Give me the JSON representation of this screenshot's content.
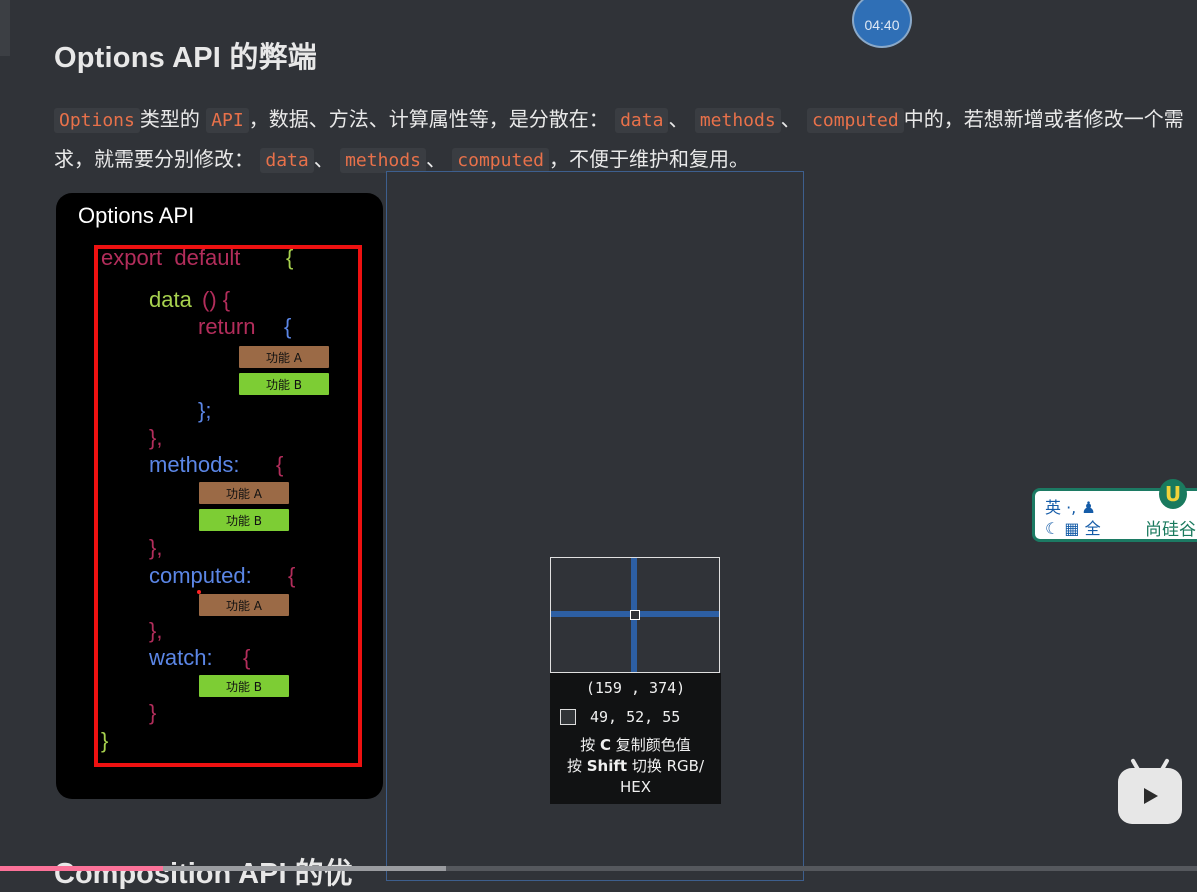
{
  "timer": "04:40",
  "heading": "Options API 的弊端",
  "paragraph": {
    "t1": "Options",
    "t2": "类型的",
    "t3": "API",
    "t4": "，数据、方法、计算属性等，是分散在：",
    "t5": "data",
    "t6": "、",
    "t7": "methods",
    "t8": "、",
    "t9": "computed",
    "t10": "中的，若想新增或者修改一个需求，就需要分别修改：",
    "t11": "data",
    "t12": "、",
    "t13": "methods",
    "t14": "、",
    "t15": "computed",
    "t16": "，不便于维护和复用。"
  },
  "diagram": {
    "title": "Options API",
    "export_kw": "export  default",
    "open_brace": "{",
    "data_fn": "data",
    "data_paren": "() {",
    "return_kw": "return",
    "return_brace": "{",
    "close_return": "};",
    "close1": "},",
    "methods": "methods:",
    "methods_brace": "{",
    "close2": "},",
    "computed": "computed:",
    "computed_brace": "{",
    "close3": "},",
    "watch": "watch:",
    "watch_brace": "{",
    "close_watch": "}",
    "close_all": "}",
    "chip_a": "功能 A",
    "chip_b": "功能 B"
  },
  "picker": {
    "coords": "(159 , 374)",
    "rgb": "49,  52,  55",
    "hint_copy_pre": "按",
    "hint_copy_key": "C",
    "hint_copy_post": "复制颜色值",
    "hint_switch_pre": "按",
    "hint_switch_key": "Shift",
    "hint_switch_post": "切换 RGB/",
    "hint_switch_post2": "HEX",
    "swatch_color": "#313437"
  },
  "ime": {
    "row1": "英 ·, ♟",
    "row2": "☾ ▦ 全",
    "logo": "U",
    "brand": "尚硅谷"
  },
  "heading2": "Composition API 的优",
  "colors": {
    "accent": "#e8714a",
    "progress": "#fb7299"
  }
}
